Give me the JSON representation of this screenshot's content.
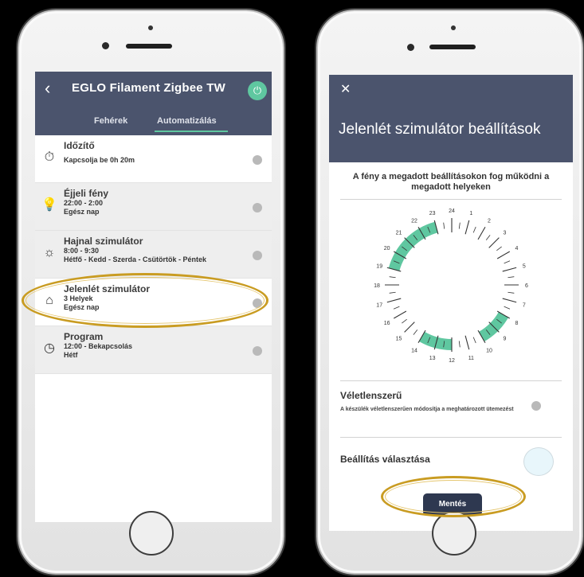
{
  "left_screen": {
    "header": {
      "title": "EGLO Filament Zigbee TW",
      "tabs": [
        "Fehérek",
        "Automatizálás"
      ]
    },
    "items": [
      {
        "icon": "timer-icon",
        "title": "Időzítő",
        "lines": [
          "Kapcsolja be 0h 20m"
        ]
      },
      {
        "icon": "night-light-icon",
        "title": "Éjjeli fény",
        "lines": [
          "22:00 - 2:00",
          "Egész nap"
        ]
      },
      {
        "icon": "sunrise-icon",
        "title": "Hajnal szimulátor",
        "lines": [
          "8:00 - 9:30",
          "Hétfő - Kedd - Szerda - Csütörtök - Péntek"
        ]
      },
      {
        "icon": "home-icon",
        "title": "Jelenlét szimulátor",
        "lines": [
          "3 Helyek",
          "Egész nap"
        ]
      },
      {
        "icon": "clock-icon",
        "title": "Program",
        "lines": [
          "12:00 - Bekapcsolás",
          "Hétf"
        ]
      }
    ]
  },
  "right_screen": {
    "title": "Jelenlét szimulátor beállítások",
    "description": "A fény a megadott beállításokon fog működni a megadott helyeken",
    "clock_hours": [
      "24",
      "1",
      "2",
      "3",
      "4",
      "5",
      "6",
      "7",
      "8",
      "9",
      "10",
      "11",
      "12",
      "13",
      "14",
      "15",
      "16",
      "17",
      "18",
      "19",
      "20",
      "21",
      "22",
      "23"
    ],
    "active_ranges": [
      [
        19,
        23
      ],
      [
        8,
        10
      ],
      [
        12,
        14
      ]
    ],
    "random": {
      "title": "Véletlenszerű",
      "description": "A készülék véletlenszerűen módosítja a meghatározott ütemezést"
    },
    "setting_choice": "Beállítás választása",
    "save_label": "Mentés"
  },
  "colors": {
    "header": "#4b546d",
    "accent": "#5fc7a0",
    "highlight": "#c99c22"
  }
}
